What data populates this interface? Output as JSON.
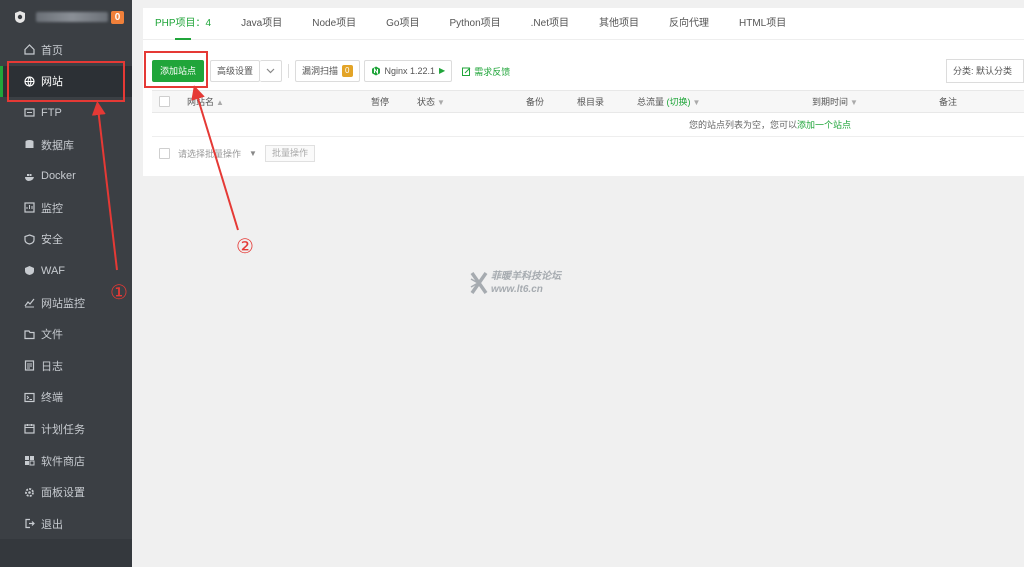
{
  "sidebar": {
    "notification_count": "0",
    "items": [
      {
        "label": "首页",
        "icon": "home-icon"
      },
      {
        "label": "网站",
        "icon": "globe-icon",
        "active": true
      },
      {
        "label": "FTP",
        "icon": "ftp-icon"
      },
      {
        "label": "数据库",
        "icon": "database-icon"
      },
      {
        "label": "Docker",
        "icon": "docker-icon"
      },
      {
        "label": "监控",
        "icon": "monitor-icon"
      },
      {
        "label": "安全",
        "icon": "shield-icon"
      },
      {
        "label": "WAF",
        "icon": "waf-icon"
      },
      {
        "label": "网站监控",
        "icon": "chart-icon"
      },
      {
        "label": "文件",
        "icon": "folder-icon"
      },
      {
        "label": "日志",
        "icon": "log-icon"
      },
      {
        "label": "终端",
        "icon": "terminal-icon"
      },
      {
        "label": "计划任务",
        "icon": "calendar-icon"
      },
      {
        "label": "软件商店",
        "icon": "store-icon"
      },
      {
        "label": "面板设置",
        "icon": "gear-icon"
      },
      {
        "label": "退出",
        "icon": "logout-icon"
      }
    ]
  },
  "tabs": [
    {
      "label": "PHP项目：4",
      "active": true
    },
    {
      "label": "Java项目"
    },
    {
      "label": "Node项目"
    },
    {
      "label": "Go项目"
    },
    {
      "label": "Python项目"
    },
    {
      "label": ".Net项目"
    },
    {
      "label": "其他项目"
    },
    {
      "label": "反向代理"
    },
    {
      "label": "HTML项目"
    }
  ],
  "toolbar": {
    "add_site": "添加站点",
    "advanced": "高级设置",
    "vuln_scan": "漏洞扫描",
    "vuln_count": "0",
    "nginx": "Nginx 1.22.1",
    "feedback": "需求反馈",
    "category": "分类: 默认分类"
  },
  "table": {
    "headers": {
      "name": "网站名",
      "stop": "暂停",
      "status": "状态",
      "backup": "备份",
      "root": "根目录",
      "traffic": "总流量",
      "switch": "(切换)",
      "expire": "到期时间",
      "remark": "备注"
    },
    "empty_text": "您的站点列表为空，您可以",
    "empty_link": "添加一个站点",
    "batch_placeholder": "请选择批量操作",
    "batch_button": "批量操作"
  },
  "watermark": {
    "line1": "菲暖羊科技论坛",
    "line2": "www.lt6.cn"
  },
  "annotations": {
    "step1": "①",
    "step2": "②"
  },
  "colors": {
    "accent": "#20a53a",
    "sidebar_bg": "#3b3f44",
    "annotation": "#e53935",
    "badge": "#f0803a"
  }
}
